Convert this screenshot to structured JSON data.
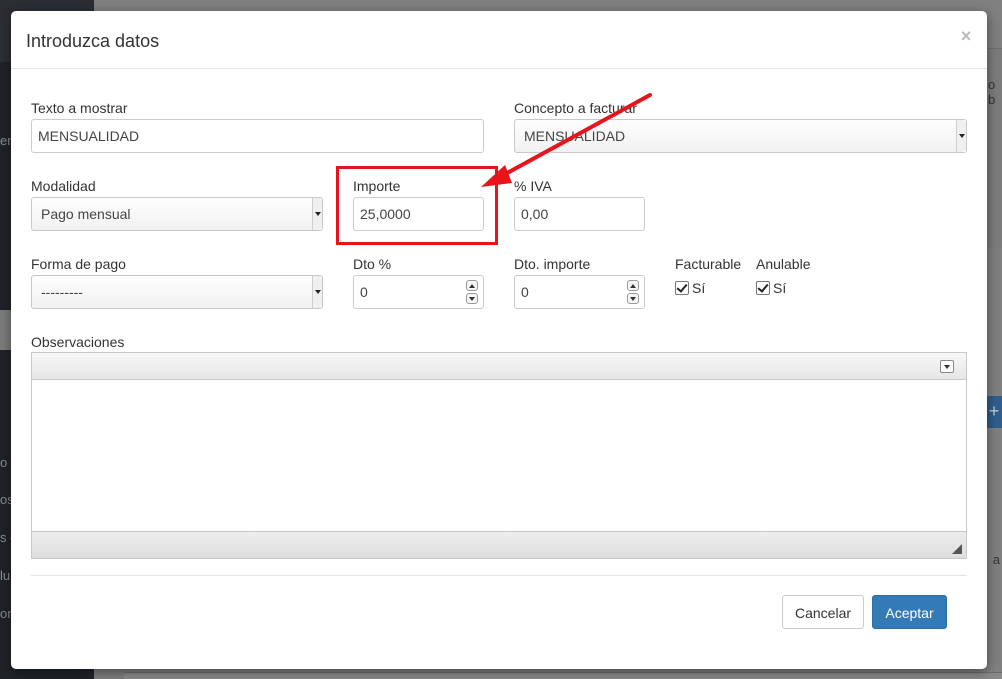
{
  "modal": {
    "title": "Introduzca datos",
    "close_glyph": "×"
  },
  "form": {
    "texto_mostrar": {
      "label": "Texto a mostrar",
      "value": "MENSUALIDAD"
    },
    "concepto_facturar": {
      "label": "Concepto a facturar",
      "value": "MENSUALIDAD"
    },
    "modalidad": {
      "label": "Modalidad",
      "value": "Pago mensual"
    },
    "importe": {
      "label": "Importe",
      "value": "25,0000"
    },
    "iva": {
      "label": "% IVA",
      "value": "0,00"
    },
    "forma_pago": {
      "label": "Forma de pago",
      "value": "---------"
    },
    "dto_pct": {
      "label": "Dto %",
      "value": "0"
    },
    "dto_importe": {
      "label": "Dto. importe",
      "value": "0"
    },
    "facturable": {
      "label": "Facturable",
      "check_label": "Sí",
      "checked": true
    },
    "anulable": {
      "label": "Anulable",
      "check_label": "Sí",
      "checked": true
    },
    "observaciones": {
      "label": "Observaciones",
      "value": ""
    }
  },
  "buttons": {
    "cancel": "Cancelar",
    "accept": "Aceptar"
  },
  "annotation": {
    "color": "#e8141c",
    "target": "importe"
  },
  "colors": {
    "primary_button": "#337ab7",
    "overlay_gray": "#7d7d7d"
  },
  "background": {
    "side_fragments": [
      "er",
      "o",
      "os",
      "s d",
      "lu",
      "or"
    ],
    "right_fragments": [
      "o b",
      "a"
    ]
  }
}
